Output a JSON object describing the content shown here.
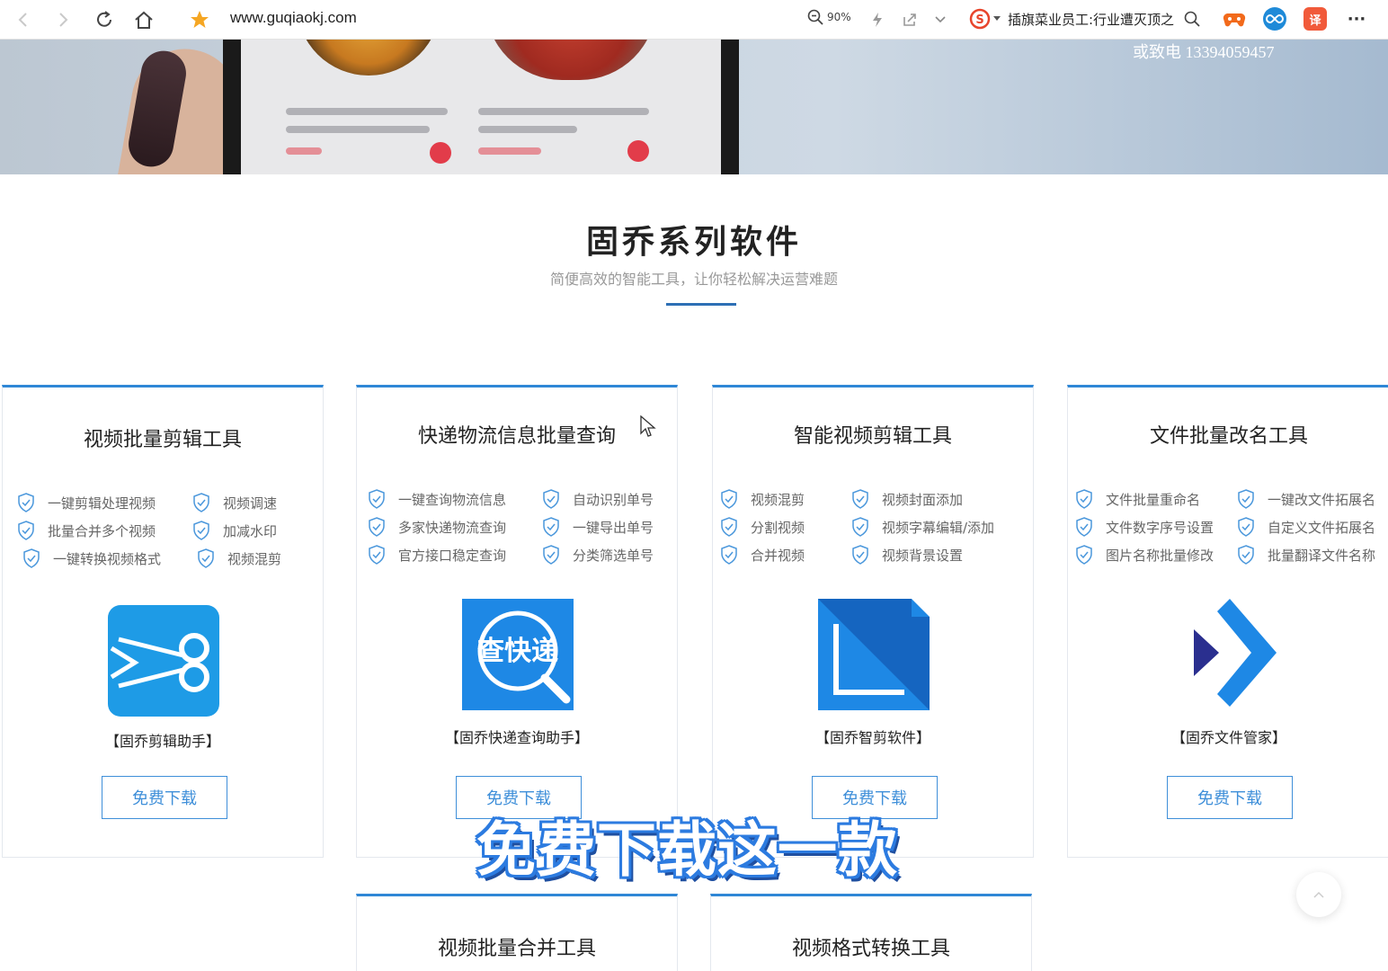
{
  "browser": {
    "url": "www.guqiaokj.com",
    "zoom_level": "90%",
    "search_text": "插旗菜业员工:行业遭灭顶之"
  },
  "hero": {
    "phone_text": "或致电 13394059457"
  },
  "section": {
    "title": "固乔系列软件",
    "subtitle": "简便高效的智能工具，让你轻松解决运营难题"
  },
  "cards": [
    {
      "title": "视频批量剪辑工具",
      "features_left": [
        "一键剪辑处理视频",
        "批量合并多个视频",
        "一键转换视频格式"
      ],
      "features_right": [
        "视频调速",
        "加减水印",
        "视频混剪"
      ],
      "caption": "【固乔剪辑助手】",
      "button": "免费下载",
      "logo_color": "#1e9be6"
    },
    {
      "title": "快递物流信息批量查询",
      "features_left": [
        "一键查询物流信息",
        "多家快递物流查询",
        "官方接口稳定查询"
      ],
      "features_right": [
        "自动识别单号",
        "一键导出单号",
        "分类筛选单号"
      ],
      "caption": "【固乔快递查询助手】",
      "button": "免费下载",
      "logo_text": "查快递",
      "logo_color": "#1e88e5"
    },
    {
      "title": "智能视频剪辑工具",
      "features_left": [
        "视频混剪",
        "分割视频",
        "合并视频"
      ],
      "features_right": [
        "视频封面添加",
        "视频字幕编辑/添加",
        "视频背景设置"
      ],
      "caption": "【固乔智剪软件】",
      "button": "免费下载",
      "logo_color": "#1e88e5"
    },
    {
      "title": "文件批量改名工具",
      "features_left": [
        "文件批量重命名",
        "文件数字序号设置",
        "图片名称批量修改"
      ],
      "features_right": [
        "一键改文件拓展名",
        "自定义文件拓展名",
        "批量翻译文件名称"
      ],
      "caption": "【固乔文件管家】",
      "button": "免费下载",
      "logo_color": "#1e88e5"
    }
  ],
  "cards_row2": [
    {
      "title": "视频批量合并工具"
    },
    {
      "title": "视频格式转换工具"
    }
  ],
  "overlay": {
    "caption": "免费下载这一款"
  },
  "colors": {
    "accent": "#2f87d6",
    "button_text": "#3f8fd9"
  }
}
